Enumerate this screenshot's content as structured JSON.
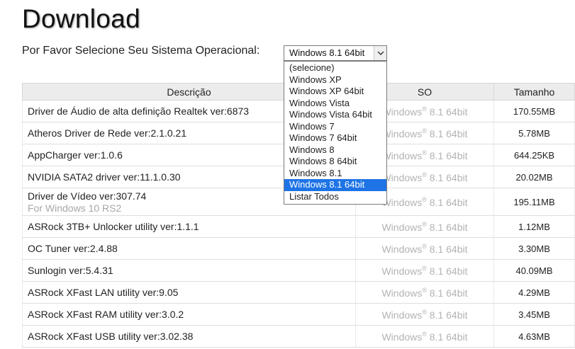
{
  "page": {
    "title": "Download",
    "os_prompt": "Por Favor Selecione Seu Sistema Operacional:"
  },
  "os_select": {
    "value": "Windows 8.1 64bit",
    "options": [
      "(selecione)",
      "Windows XP",
      "Windows XP 64bit",
      "Windows Vista",
      "Windows Vista 64bit",
      "Windows 7",
      "Windows 7 64bit",
      "Windows 8",
      "Windows 8 64bit",
      "Windows 8.1",
      "Windows 8.1 64bit",
      "Listar Todos"
    ],
    "selected_index": 10,
    "arrow_icon": "chevron-down-icon"
  },
  "table": {
    "headers": [
      "Descrição",
      "SO",
      "Tamanho"
    ],
    "rows": [
      {
        "desc": "Driver de Áudio de alta definição Realtek ver:6873",
        "sub": "",
        "os_brand": "Windows",
        "os_mark": "®",
        "os_version": " 8.1 64bit",
        "size": "170.55MB"
      },
      {
        "desc": "Atheros Driver de Rede ver:2.1.0.21",
        "sub": "",
        "os_brand": "Windows",
        "os_mark": "®",
        "os_version": " 8.1 64bit",
        "size": "5.78MB"
      },
      {
        "desc": "AppCharger ver:1.0.6",
        "sub": "",
        "os_brand": "Windows",
        "os_mark": "®",
        "os_version": " 8.1 64bit",
        "size": "644.25KB"
      },
      {
        "desc": "NVIDIA SATA2 driver ver:11.1.0.30",
        "sub": "",
        "os_brand": "Windows",
        "os_mark": "®",
        "os_version": " 8.1 64bit",
        "size": "20.02MB"
      },
      {
        "desc": "Driver de Vídeo ver:307.74",
        "sub": "For Windows 10 RS2",
        "os_brand": "Windows",
        "os_mark": "®",
        "os_version": " 8.1 64bit",
        "size": "195.11MB"
      },
      {
        "desc": "ASRock 3TB+ Unlocker utility ver:1.1.1",
        "sub": "",
        "os_brand": "Windows",
        "os_mark": "®",
        "os_version": " 8.1 64bit",
        "size": "1.12MB"
      },
      {
        "desc": "OC Tuner ver:2.4.88",
        "sub": "",
        "os_brand": "Windows",
        "os_mark": "®",
        "os_version": " 8.1 64bit",
        "size": "3.30MB"
      },
      {
        "desc": "Sunlogin ver:5.4.31",
        "sub": "",
        "os_brand": "Windows",
        "os_mark": "®",
        "os_version": " 8.1 64bit",
        "size": "40.09MB"
      },
      {
        "desc": "ASRock XFast LAN utility ver:9.05",
        "sub": "",
        "os_brand": "Windows",
        "os_mark": "®",
        "os_version": " 8.1 64bit",
        "size": "4.29MB"
      },
      {
        "desc": "ASRock XFast RAM utility ver:3.0.2",
        "sub": "",
        "os_brand": "Windows",
        "os_mark": "®",
        "os_version": " 8.1 64bit",
        "size": "3.45MB"
      },
      {
        "desc": "ASRock XFast USB utility ver:3.02.38",
        "sub": "",
        "os_brand": "Windows",
        "os_mark": "®",
        "os_version": " 8.1 64bit",
        "size": "4.63MB"
      }
    ]
  },
  "colors": {
    "selected_option_bg": "#1e74e6",
    "header_bg": "#ececec",
    "muted_text": "#b3b3b3"
  }
}
